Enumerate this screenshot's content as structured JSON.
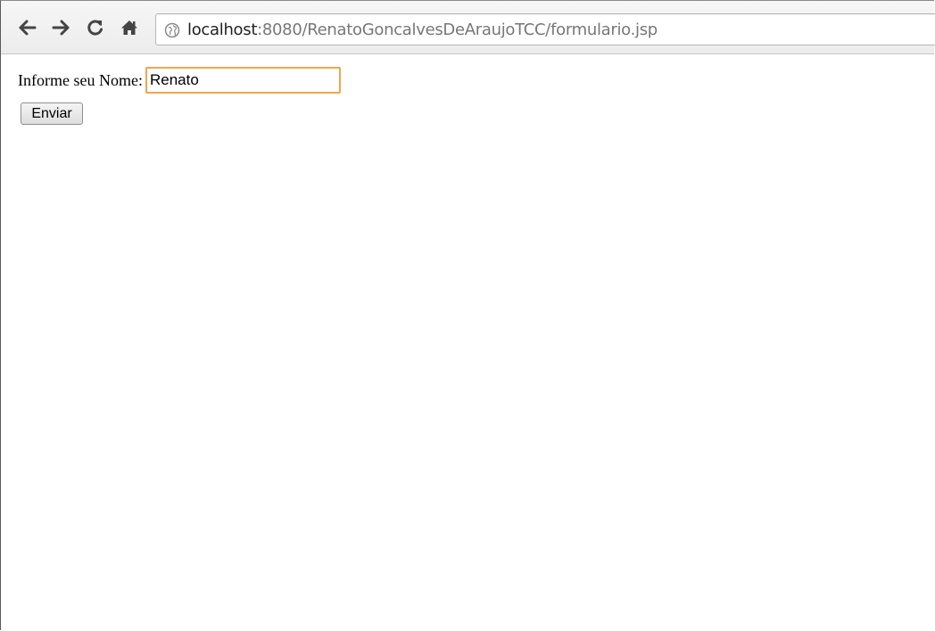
{
  "browser": {
    "toolbar_buttons": [
      {
        "name": "back",
        "icon": "arrow-left-icon"
      },
      {
        "name": "forward",
        "icon": "arrow-right-icon"
      },
      {
        "name": "reload",
        "icon": "reload-icon"
      },
      {
        "name": "home",
        "icon": "home-icon"
      }
    ],
    "address_bar": {
      "icon": "globe-icon",
      "host": "localhost",
      "path": ":8080/RenatoGoncalvesDeAraujoTCC/formulario.jsp"
    }
  },
  "form": {
    "name_label": "Informe seu Nome:",
    "name_value": "Renato",
    "submit_label": "Enviar"
  },
  "colors": {
    "input_focus_border": "#f0a64c",
    "toolbar_bg": "#ececec",
    "url_path": "#777777"
  }
}
